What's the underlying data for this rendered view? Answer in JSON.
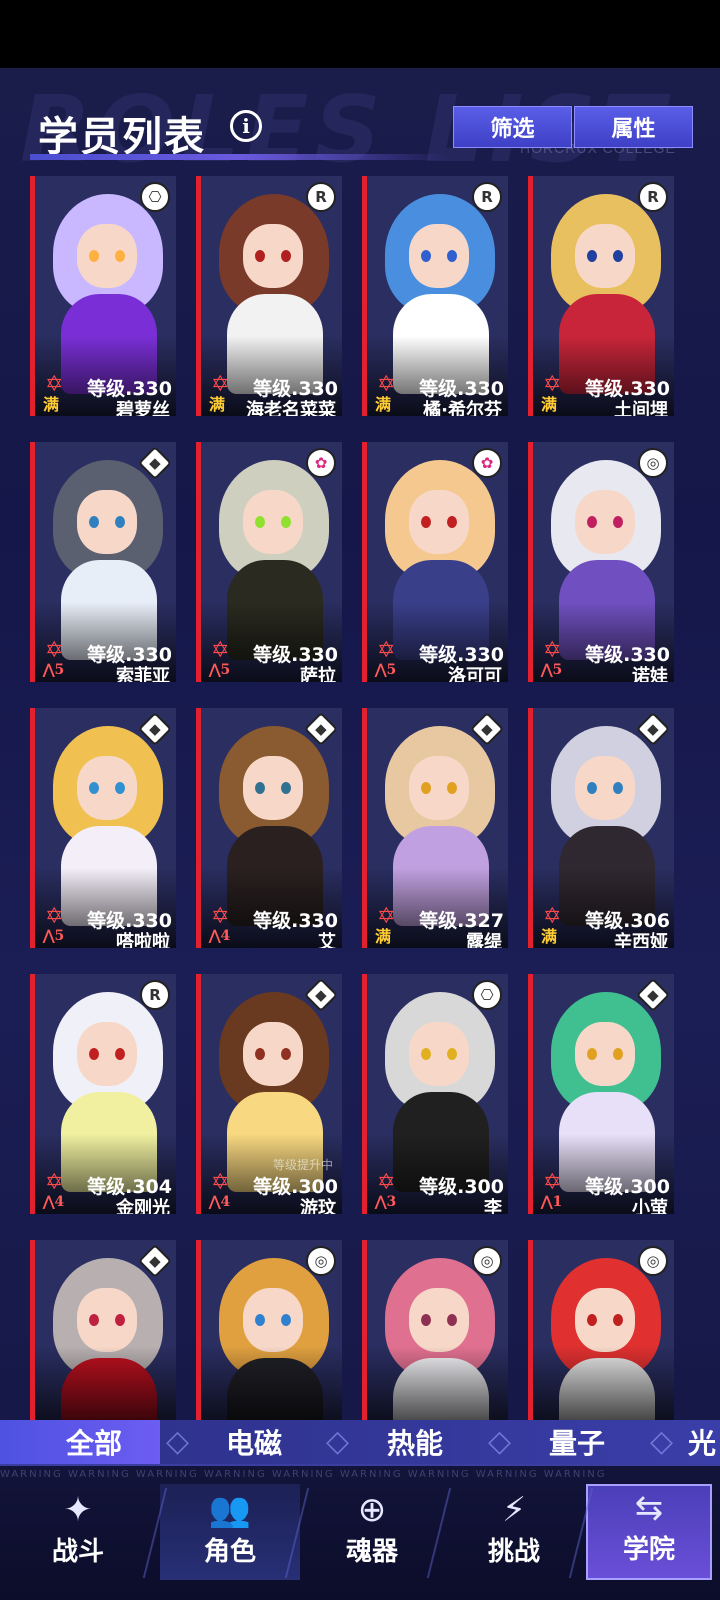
{
  "header": {
    "title": "学员列表",
    "info_icon": "i",
    "watermark": "ROLES LIST",
    "subtitle": "HORCRUX COLLEGE",
    "filter_label": "筛选",
    "attribute_label": "属性"
  },
  "cards": [
    {
      "name": "碧萝丝",
      "level": "等级.330",
      "rank": "满",
      "badge": "gamepad",
      "badge_glyph": "⎔",
      "hair": "#c9b8ff",
      "eye": "#ffb040",
      "body": "#7a2fd6"
    },
    {
      "name": "海老名菜菜",
      "level": "等级.330",
      "rank": "满",
      "badge": "R",
      "badge_glyph": "R",
      "hair": "#7a3a2a",
      "eye": "#b02020",
      "body": "#f2f2f2"
    },
    {
      "name": "橘·希尔芬",
      "level": "等级.330",
      "rank": "满",
      "badge": "R",
      "badge_glyph": "R",
      "hair": "#4a8ee0",
      "eye": "#3060d0",
      "body": "#ffffff"
    },
    {
      "name": "土间埋",
      "level": "等级.330",
      "rank": "满",
      "badge": "R",
      "badge_glyph": "R",
      "hair": "#e9c060",
      "eye": "#2040a0",
      "body": "#c8253a"
    },
    {
      "name": "索菲亚",
      "level": "等级.330",
      "rank": "5",
      "badge": "diamond",
      "badge_glyph": "◆",
      "hair": "#5a6070",
      "eye": "#3080c0",
      "body": "#e8eef8"
    },
    {
      "name": "萨拉",
      "level": "等级.330",
      "rank": "5",
      "badge": "pink",
      "badge_glyph": "✿",
      "hair": "#cfcfc0",
      "eye": "#90e030",
      "body": "#2a2a20"
    },
    {
      "name": "洛可可",
      "level": "等级.330",
      "rank": "5",
      "badge": "pink",
      "badge_glyph": "✿",
      "hair": "#f5c890",
      "eye": "#c02020",
      "body": "#3a3f8a"
    },
    {
      "name": "诺娃",
      "level": "等级.330",
      "rank": "5",
      "badge": "swirl",
      "badge_glyph": "◎",
      "hair": "#e8e8f0",
      "eye": "#c02060",
      "body": "#7050c0"
    },
    {
      "name": "嗒啦啦",
      "level": "等级.330",
      "rank": "5",
      "badge": "diamond",
      "badge_glyph": "◆",
      "hair": "#f0c050",
      "eye": "#3090d0",
      "body": "#f4eef8"
    },
    {
      "name": "艾",
      "level": "等级.330",
      "rank": "4",
      "badge": "diamond",
      "badge_glyph": "◆",
      "hair": "#8a5a30",
      "eye": "#307090",
      "body": "#2a2020"
    },
    {
      "name": "露缇",
      "level": "等级.327",
      "rank": "满",
      "badge": "diamond",
      "badge_glyph": "◆",
      "hair": "#e8c8a0",
      "eye": "#e0a020",
      "body": "#c0a0e0"
    },
    {
      "name": "辛西娅",
      "level": "等级.306",
      "rank": "满",
      "badge": "diamond",
      "badge_glyph": "◆",
      "hair": "#d0d0e0",
      "eye": "#3080c0",
      "body": "#302830"
    },
    {
      "name": "金刚光",
      "level": "等级.304",
      "rank": "4",
      "badge": "R",
      "badge_glyph": "R",
      "hair": "#f0f0f8",
      "eye": "#c02020",
      "body": "#f0f0a0"
    },
    {
      "name": "游玟",
      "level": "等级.300",
      "rank": "4",
      "badge": "diamond",
      "badge_glyph": "◆",
      "hair": "#6a3a20",
      "eye": "#903020",
      "body": "#f8d880",
      "upgrade": "等级提升中"
    },
    {
      "name": "李",
      "level": "等级.300",
      "rank": "3",
      "badge": "gamepad",
      "badge_glyph": "⎔",
      "hair": "#d8d8d8",
      "eye": "#e0b020",
      "body": "#202020"
    },
    {
      "name": "小萤",
      "level": "等级.300",
      "rank": "1",
      "badge": "diamond",
      "badge_glyph": "◆",
      "hair": "#40c090",
      "eye": "#e0a020",
      "body": "#e8e0f8"
    },
    {
      "name": "",
      "level": "",
      "rank": "",
      "badge": "diamond",
      "badge_glyph": "◆",
      "hair": "#b8b0b0",
      "eye": "#c02040",
      "body": "#c01020"
    },
    {
      "name": "",
      "level": "",
      "rank": "",
      "badge": "swirl",
      "badge_glyph": "◎",
      "hair": "#e0a040",
      "eye": "#3080d0",
      "body": "#202028"
    },
    {
      "name": "",
      "level": "",
      "rank": "",
      "badge": "swirl",
      "badge_glyph": "◎",
      "hair": "#e07090",
      "eye": "#903050",
      "body": "#f4f4f8"
    },
    {
      "name": "",
      "level": "",
      "rank": "",
      "badge": "swirl",
      "badge_glyph": "◎",
      "hair": "#e03030",
      "eye": "#c02020",
      "body": "#e8e8e8"
    }
  ],
  "element_tabs": [
    {
      "label": "全部",
      "icon": "all-icon"
    },
    {
      "label": "电磁",
      "icon": "electromagnetic-icon"
    },
    {
      "label": "热能",
      "icon": "thermal-icon"
    },
    {
      "label": "量子",
      "icon": "quantum-icon"
    },
    {
      "label": "光",
      "icon": "light-icon"
    }
  ],
  "nav": {
    "warning": "WARNING   WARNING   WARNING   WARNING   WARNING   WARNING   WARNING   WARNING   WARNING",
    "items": [
      {
        "label": "战斗",
        "icon": "battle-icon",
        "glyph": "✦"
      },
      {
        "label": "角色",
        "icon": "roles-icon",
        "glyph": "👥"
      },
      {
        "label": "魂器",
        "icon": "horcrux-icon",
        "glyph": "⊕"
      },
      {
        "label": "挑战",
        "icon": "challenge-icon",
        "glyph": "⚡"
      },
      {
        "label": "学院",
        "icon": "college-icon",
        "glyph": "⇆"
      }
    ]
  },
  "colors": {
    "accent": "#5a5ee8",
    "card_border": "#e3202d",
    "rank_gold": "#ffcc33"
  }
}
